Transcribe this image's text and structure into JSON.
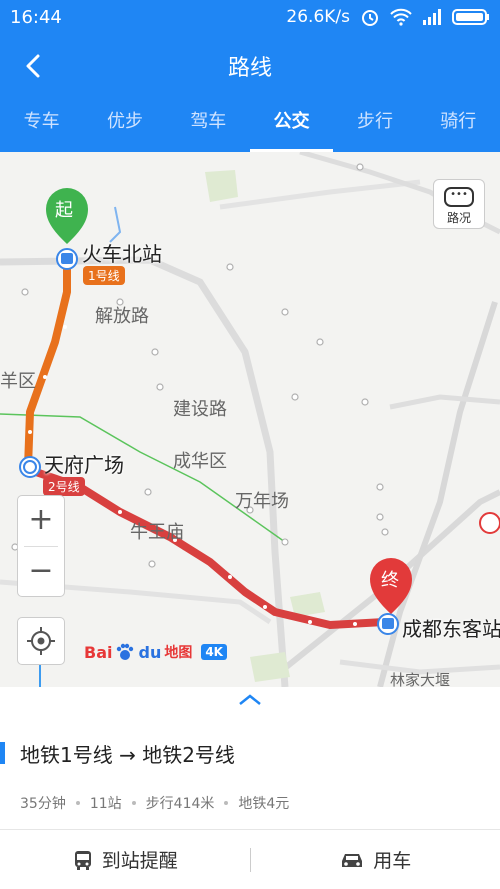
{
  "status_bar": {
    "time": "16:44",
    "speed": "26.6K/s"
  },
  "header": {
    "title": "路线"
  },
  "tabs": [
    {
      "label": "专车"
    },
    {
      "label": "优步"
    },
    {
      "label": "驾车"
    },
    {
      "label": "公交"
    },
    {
      "label": "步行"
    },
    {
      "label": "骑行"
    }
  ],
  "active_tab": "公交",
  "map": {
    "traffic_button": "路况",
    "zoom_in": "+",
    "zoom_out": "−",
    "start_marker": "起",
    "end_marker": "终",
    "stations": {
      "start": "火车北站",
      "transfer": "天府广场",
      "end": "成都东客站"
    },
    "line_tags": {
      "line1": "1号线",
      "line2": "2号线"
    },
    "place_labels": {
      "jiefang": "解放路",
      "yangqu": "羊区",
      "jianshe": "建设路",
      "chenghua": "成华区",
      "wannian": "万年场",
      "niuwang": "牛王庙",
      "linjia": "林家大堰"
    },
    "brand": {
      "bai": "Bai",
      "du": "du",
      "ditu": "地图",
      "k4": "4K"
    },
    "colors": {
      "line1": "#e8711c",
      "line2": "#d8403f",
      "accent": "#1f86f4"
    }
  },
  "route": {
    "title": "地铁1号线 → 地铁2号线",
    "duration": "35分钟",
    "stops": "11站",
    "walk": "步行414米",
    "fare": "地铁4元"
  },
  "actions": {
    "remind": "到站提醒",
    "car": "用车"
  }
}
